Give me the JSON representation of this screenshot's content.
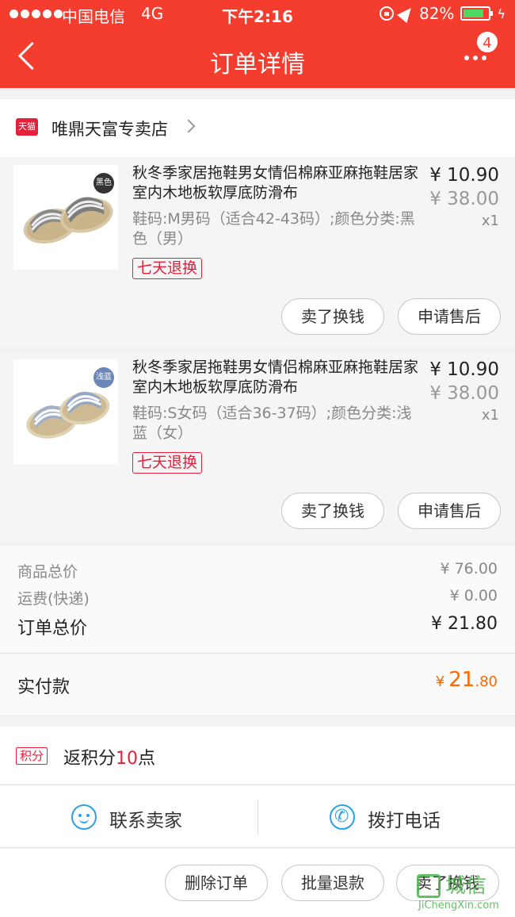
{
  "status_bar": {
    "carrier": "中国电信",
    "network": "4G",
    "time": "下午2:16",
    "battery": "82%",
    "battery_level": 0.82
  },
  "header": {
    "title": "订单详情",
    "badge_count": "4"
  },
  "store": {
    "tag": "天猫",
    "name": "唯鼎天富专卖店"
  },
  "items": [
    {
      "title": "秋冬季家居拖鞋男女情侣棉麻亚麻拖鞋居家室内木地板软厚底防滑布",
      "spec": "鞋码:M男码（适合42-43码）;颜色分类:黑色（男）",
      "color_tag": "黑色",
      "color_tag_color": "#333333",
      "return_tag": "七天退换",
      "price": "¥ 10.90",
      "original_price": "¥ 38.00",
      "quantity": "x1",
      "btn_sell": "卖了换钱",
      "btn_after_sale": "申请售后"
    },
    {
      "title": "秋冬季家居拖鞋男女情侣棉麻亚麻拖鞋居家室内木地板软厚底防滑布",
      "spec": "鞋码:S女码（适合36-37码）;颜色分类:浅蓝（女）",
      "color_tag": "浅蓝",
      "color_tag_color": "#6b86b8",
      "return_tag": "七天退换",
      "price": "¥ 10.90",
      "original_price": "¥ 38.00",
      "quantity": "x1",
      "btn_sell": "卖了换钱",
      "btn_after_sale": "申请售后"
    }
  ],
  "summary": {
    "goods_total_label": "商品总价",
    "goods_total": "¥ 76.00",
    "shipping_label": "运费(快递)",
    "shipping": "¥ 0.00",
    "order_total_label": "订单总价",
    "order_total": "¥ 21.80",
    "paid_label": "实付款",
    "paid_currency": "¥",
    "paid_int": "21",
    "paid_dec": ".80"
  },
  "points": {
    "tag": "积分",
    "text": "返积分",
    "value": "10",
    "unit": "点"
  },
  "contact": {
    "seller": "联系卖家",
    "call": "拨打电话"
  },
  "footer": {
    "delete": "删除订单",
    "batch_refund": "批量退款",
    "sell": "卖了换钱"
  },
  "watermark": {
    "cn": "城信",
    "en": "JiChengXin.com"
  },
  "colors": {
    "header": "#f43d2f",
    "accent_red": "#e5203a",
    "paid_orange": "#ff6600",
    "contact_blue": "#29a1e8"
  }
}
